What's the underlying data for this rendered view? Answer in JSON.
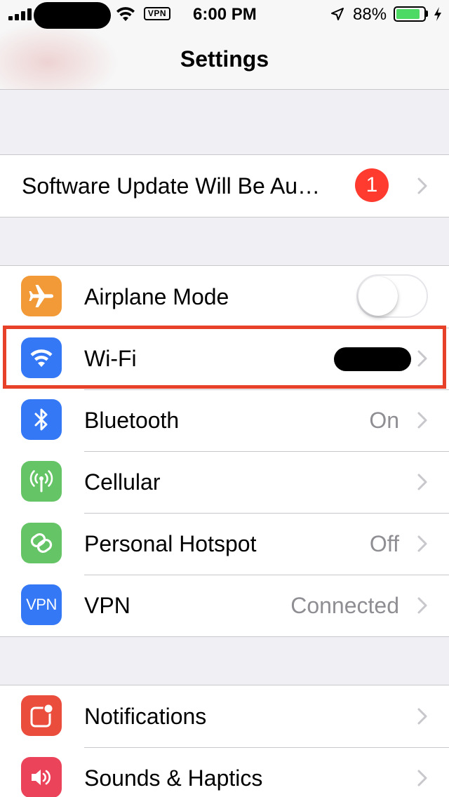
{
  "status_bar": {
    "time": "6:00 PM",
    "vpn_badge": "VPN",
    "battery_percent": "88%",
    "battery_level": 0.88,
    "battery_color": "#4cd964"
  },
  "nav": {
    "title": "Settings"
  },
  "software_update": {
    "label": "Software Update Will Be Au…",
    "badge_count": "1",
    "badge_color": "#ff3b30"
  },
  "connectivity": [
    {
      "label": "Airplane Mode",
      "icon": "airplane-icon",
      "icon_color": "#f19a37",
      "toggle_on": false
    },
    {
      "label": "Wi-Fi",
      "icon": "wifi-icon",
      "icon_color": "#3478f6",
      "value_redacted": true,
      "highlighted": true
    },
    {
      "label": "Bluetooth",
      "icon": "bluetooth-icon",
      "icon_color": "#3478f6",
      "value": "On"
    },
    {
      "label": "Cellular",
      "icon": "cellular-icon",
      "icon_color": "#65c466",
      "value": ""
    },
    {
      "label": "Personal Hotspot",
      "icon": "hotspot-icon",
      "icon_color": "#65c466",
      "value": "Off"
    },
    {
      "label": "VPN",
      "icon": "vpn-icon",
      "icon_text": "VPN",
      "icon_color": "#3478f6",
      "value": "Connected"
    }
  ],
  "system": [
    {
      "label": "Notifications",
      "icon": "notifications-icon",
      "icon_color": "#eb4d3d"
    },
    {
      "label": "Sounds & Haptics",
      "icon": "speaker-icon",
      "icon_color": "#eb445a"
    }
  ],
  "highlight_color": "#e8412a"
}
